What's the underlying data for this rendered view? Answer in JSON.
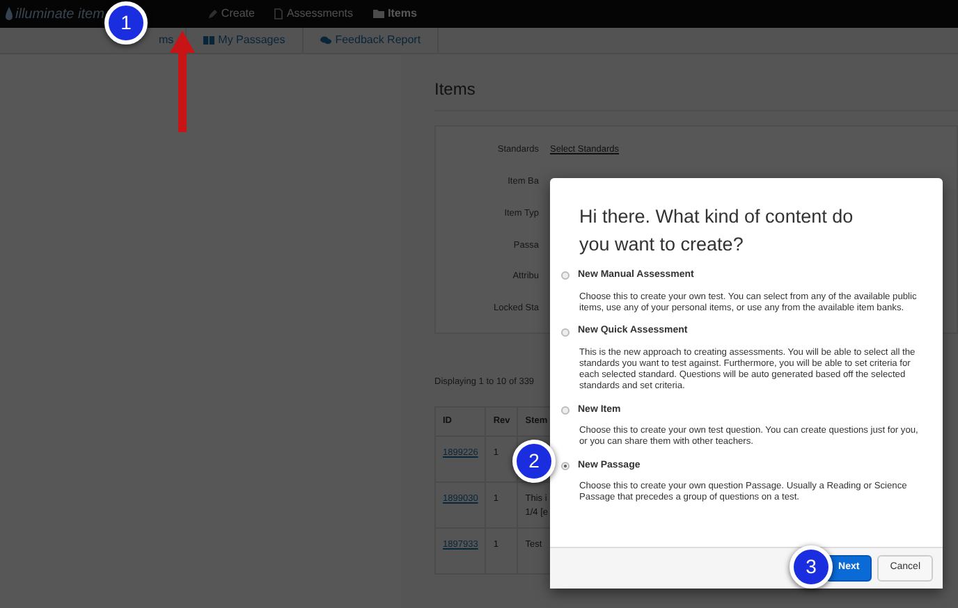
{
  "top_nav": {
    "brand": "illuminate item",
    "links": [
      {
        "label": "Create",
        "selected": false
      },
      {
        "label": "Assessments",
        "selected": false
      },
      {
        "label": "Items",
        "selected": true
      }
    ]
  },
  "sub_nav": {
    "tabs": [
      {
        "label": "ms"
      },
      {
        "label": "My Passages"
      },
      {
        "label": "Feedback Report"
      }
    ]
  },
  "page": {
    "title": "Items",
    "filters": [
      {
        "label": "Standards",
        "value": "Select Standards"
      },
      {
        "label": "Item Ba"
      },
      {
        "label": "Item Typ"
      },
      {
        "label": "Passa"
      },
      {
        "label": "Attribu"
      },
      {
        "label": "Locked Sta"
      }
    ],
    "summary": "Displaying 1 to 10 of 339",
    "table": {
      "columns": [
        "ID",
        "Rev",
        "Stem"
      ],
      "rows": [
        {
          "id": "1899226",
          "rev": "1",
          "stem": []
        },
        {
          "id": "1899030",
          "rev": "1",
          "stem": [
            "This i",
            "1/4 [e"
          ]
        },
        {
          "id": "1897933",
          "rev": "1",
          "stem": [
            "Test"
          ]
        }
      ]
    }
  },
  "modal": {
    "title": "Hi there. What kind of content do you want to create?",
    "options": [
      {
        "label": "New Manual Assessment",
        "description": "Choose this to create your own test. You can select from any of the available public items, use any of your personal items, or use any from the available item banks.",
        "selected": false
      },
      {
        "label": "New Quick Assessment",
        "description": "This is the new approach to creating assessments. You will be able to select all the standards you want to test against. Furthermore, you will be able to set criteria for each selected standard. Questions will be auto generated based off the selected standards and set criteria.",
        "selected": false
      },
      {
        "label": "New Item",
        "description": "Choose this to create your own test question. You can create questions just for you, or you can share them with other teachers.",
        "selected": false
      },
      {
        "label": "New Passage",
        "description": "Choose this to create your own question Passage. Usually a Reading or Science Passage that precedes a group of questions on a test.",
        "selected": true
      }
    ],
    "buttons": [
      {
        "label": "Next",
        "kind": "primary"
      },
      {
        "label": "Cancel",
        "kind": "secondary"
      }
    ]
  },
  "callouts": [
    "1",
    "2",
    "3"
  ]
}
